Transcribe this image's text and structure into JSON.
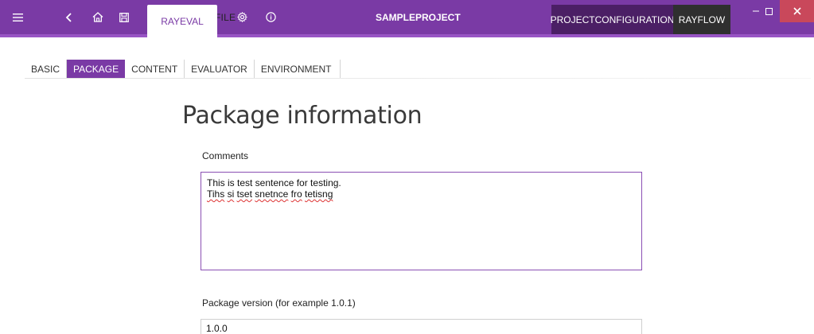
{
  "titlebar": {
    "menu_label": "FILE",
    "active_tab": "RAYEVAL",
    "project_title": "SAMPLEPROJECT",
    "right_tabs": [
      "PROJECTCONFIGURATION",
      "RAYFLOW"
    ],
    "colors": {
      "bar": "#7a3aa5",
      "projconf": "#4b1f65",
      "rayflow": "#2f2f2f",
      "close": "#c9485b"
    },
    "icons": [
      "hamburger-menu-icon",
      "back-arrow-icon",
      "home-icon",
      "save-disk-icon",
      "gear-icon",
      "info-icon",
      "minimize-icon",
      "maximize-icon",
      "close-icon"
    ]
  },
  "subtabs": {
    "items": [
      "BASIC",
      "PACKAGE",
      "CONTENT",
      "EVALUATOR",
      "ENVIRONMENT"
    ],
    "active": "PACKAGE"
  },
  "main": {
    "heading": "Package information",
    "comments_label": "Comments",
    "comments_line1": "This is test sentence for testing.",
    "comments_line2_words": [
      "Tihs",
      "si",
      "tset",
      "snetnce",
      "fro",
      "tetisng"
    ],
    "version_label": "Package version (for example 1.0.1)",
    "version_value": "1.0.0"
  }
}
